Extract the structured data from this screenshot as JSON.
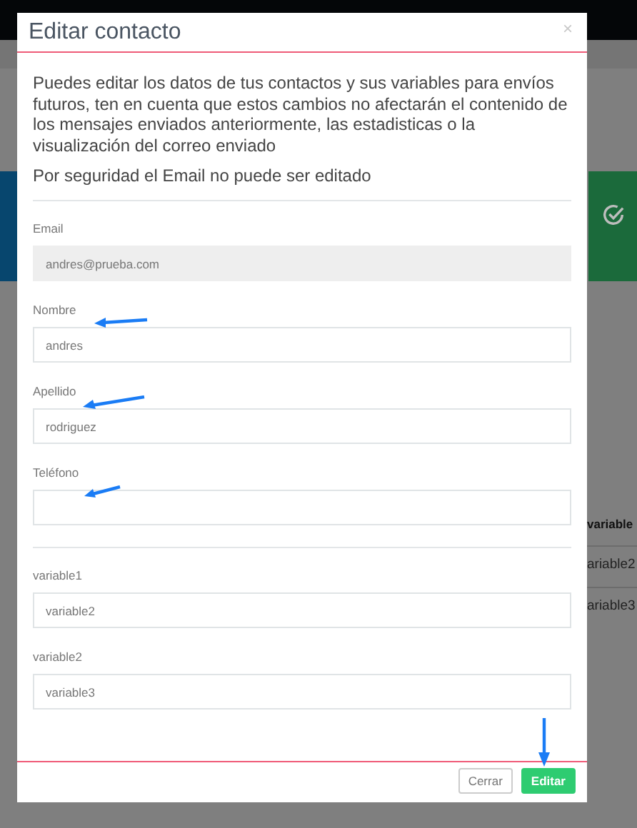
{
  "window": {
    "title": "Editar contacto",
    "close": "×"
  },
  "intro": "Puedes editar los datos de tus contactos y sus variables para envíos futuros, ten en cuenta que estos cambios no afectarán el contenido de los mensajes enviados anteriormente, las estadisticas o la visualización del correo enviado",
  "notice": "Por seguridad el Email no puede ser editado",
  "fields": [
    {
      "label": "Email",
      "value": "andres@prueba.com",
      "disabled": true
    },
    {
      "label": "Nombre",
      "value": "andres",
      "disabled": false
    },
    {
      "label": "Apellido",
      "value": "rodriguez",
      "disabled": false
    },
    {
      "label": "Teléfono",
      "disabled": false
    }
  ],
  "variables": [
    {
      "label": "variable1",
      "value": "variable2",
      "disabled": false
    },
    {
      "label": "variable2",
      "value": "variable3",
      "disabled": false
    }
  ],
  "buttons": [
    {
      "label": "Cerrar",
      "kind": "secondary"
    },
    {
      "label": "Editar",
      "kind": "primary"
    }
  ],
  "background_table": {
    "header": "variable",
    "cells": [
      "ariable2",
      "ariable3"
    ]
  }
}
